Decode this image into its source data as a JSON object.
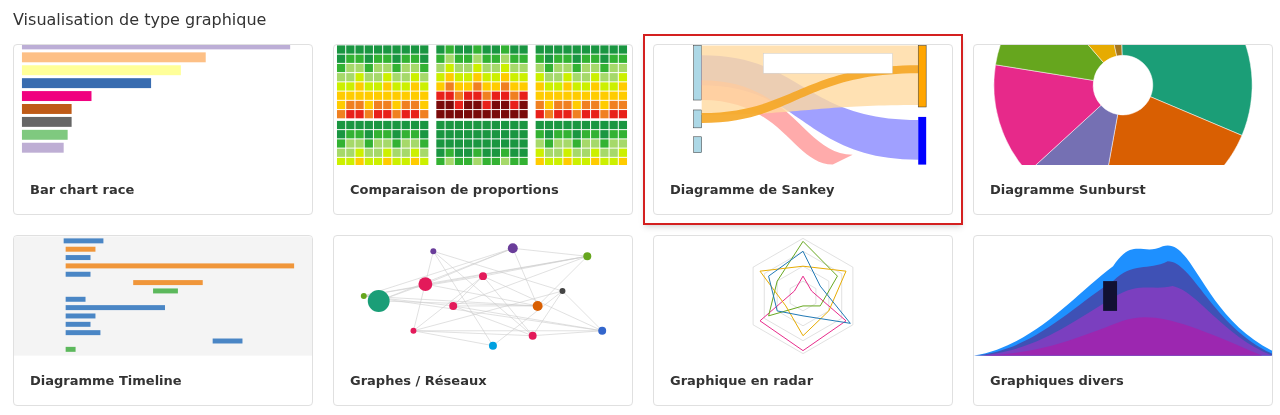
{
  "section_title": "Visualisation de type graphique",
  "cards": [
    {
      "title": "Bar chart race",
      "kind": "barrace",
      "selected": false
    },
    {
      "title": "Comparaison de proportions",
      "kind": "waffle",
      "selected": false
    },
    {
      "title": "Diagramme de Sankey",
      "kind": "sankey",
      "selected": true
    },
    {
      "title": "Diagramme Sunburst",
      "kind": "sunburst",
      "selected": false
    },
    {
      "title": "Diagramme Timeline",
      "kind": "timeline",
      "selected": false
    },
    {
      "title": "Graphes / Réseaux",
      "kind": "network",
      "selected": false
    },
    {
      "title": "Graphique en radar",
      "kind": "radar",
      "selected": false
    },
    {
      "title": "Graphiques divers",
      "kind": "stream",
      "selected": false
    }
  ]
}
